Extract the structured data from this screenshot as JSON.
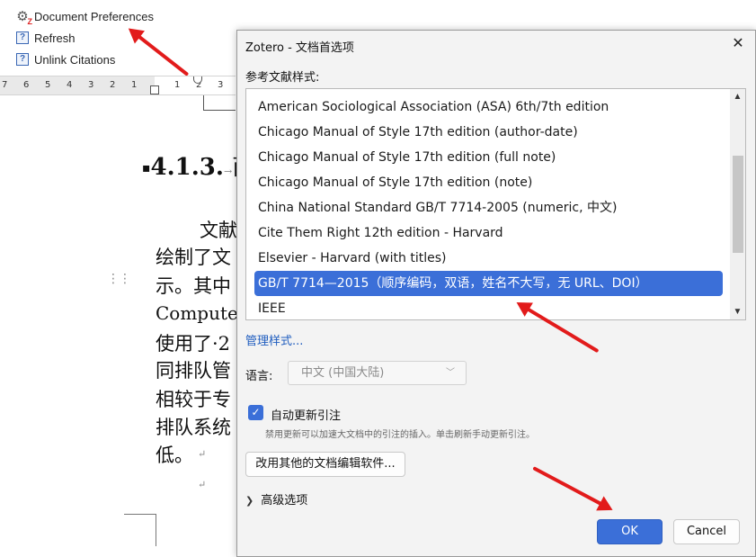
{
  "menu": {
    "doc_prefs": "Document Preferences",
    "refresh": "Refresh",
    "unlink": "Unlink Citations"
  },
  "ruler": {
    "numbers": [
      "7",
      "6",
      "5",
      "4",
      "3",
      "2",
      "1",
      "1",
      "2",
      "3"
    ]
  },
  "document": {
    "heading_num": "4.1.3.",
    "heading_rest": "",
    "heading_char": "商",
    "lines": [
      "文献",
      "绘制了文",
      "示。其中",
      "Computer",
      "使用了·2",
      "同排队管",
      "相较于专",
      "排队系统",
      "低。"
    ]
  },
  "dialog": {
    "title": "Zotero - 文档首选项",
    "style_label": "参考文献样式:",
    "styles": [
      "American Sociological Association (ASA) 6th/7th edition",
      "Chicago Manual of Style 17th edition (author-date)",
      "Chicago Manual of Style 17th edition (full note)",
      "Chicago Manual of Style 17th edition (note)",
      "China National Standard GB/T 7714-2005 (numeric, 中文)",
      "Cite Them Right 12th edition - Harvard",
      "Elsevier - Harvard (with titles)",
      "GB/T 7714—2015（顺序编码，双语，姓名不大写，无 URL、DOI）",
      "IEEE"
    ],
    "selected_index": 7,
    "manage_link": "管理样式...",
    "language_label": "语言:",
    "language_value": "中文 (中国大陆)",
    "auto_update_label": "自动更新引注",
    "auto_update_hint": "禁用更新可以加速大文档中的引注的插入。单击刷新手动更新引注。",
    "switch_button": "改用其他的文档编辑软件...",
    "advanced": "高级选项",
    "ok": "OK",
    "cancel": "Cancel"
  },
  "colors": {
    "accent": "#3b6fd8",
    "arrow": "#e21b1b"
  }
}
